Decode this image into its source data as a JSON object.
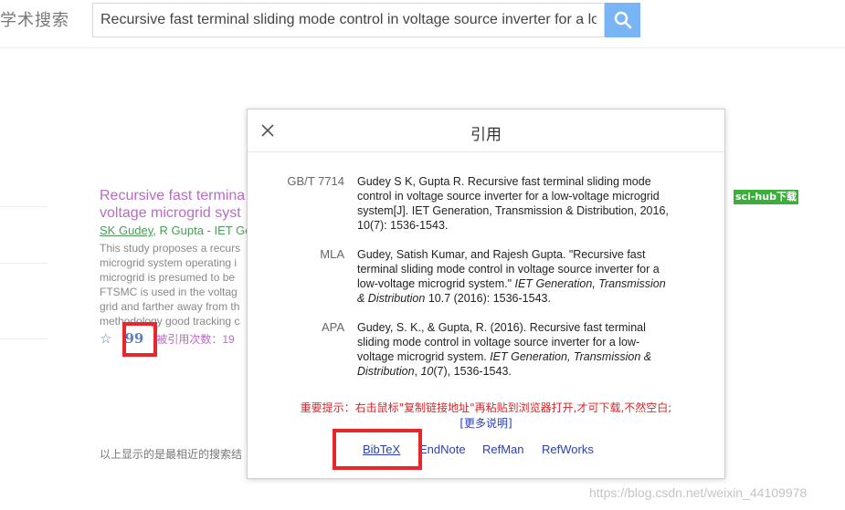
{
  "header": {
    "logo_text": "学术搜索",
    "search_value": "Recursive fast terminal sliding mode control in voltage source inverter for a lo",
    "search_icon": "search-icon"
  },
  "result": {
    "title_line1": "Recursive fast termina",
    "title_line2": "voltage microgrid syst",
    "author_linked": "SK Gudey",
    "author_rest": ", R Gupta - IET Ge",
    "snippet": [
      "This study proposes a recurs",
      "microgrid system operating i",
      "microgrid is presumed to be",
      "FTSMC is used in the voltag",
      "grid and farther away from th",
      "methodology good tracking c"
    ],
    "quote_glyph": "99",
    "cited_by": "被引用次数：19",
    "scihub_label": "sci-hub下载"
  },
  "footer_note": "以上显示的是最相近的搜索结",
  "modal": {
    "title": "引用",
    "citations": [
      {
        "label": "GB/T 7714",
        "lines": [
          "Gudey S K, Gupta R. Recursive fast terminal sliding mode",
          "control in voltage source inverter for a low-voltage microgrid",
          "system[J]. IET Generation, Transmission & Distribution, 2016,",
          "10(7): 1536-1543."
        ]
      },
      {
        "label": "MLA",
        "line1": "Gudey, Satish Kumar, and Rajesh Gupta. \"Recursive fast",
        "line2": "terminal sliding mode control in voltage source inverter for a",
        "line3_a": "low-voltage microgrid system.\" ",
        "line3_b": "IET Generation, Transmission",
        "line4_a": "& Distribution",
        "line4_b": " 10.7 (2016): 1536-1543."
      },
      {
        "label": "APA",
        "line1": "Gudey, S. K., & Gupta, R. (2016). Recursive fast terminal",
        "line2": "sliding mode control in voltage source inverter for a low-",
        "line3_a": "voltage microgrid system. ",
        "line3_b": "IET Generation, Transmission &",
        "line4_a": "Distribution",
        "line4_b": ", ",
        "line4_c": "10",
        "line4_d": "(7), 1536-1543."
      }
    ],
    "notice": "重要提示：右击鼠标\"复制链接地址\"再粘贴到浏览器打开,才可下载,不然空白;",
    "more_link": "[更多说明]",
    "export_links": [
      "BibTeX",
      "EndNote",
      "RefMan",
      "RefWorks"
    ]
  },
  "watermark": "https://blog.csdn.net/weixin_44109978",
  "colors": {
    "highlight": "#e8272d",
    "link": "#2a3fb3",
    "visited_title": "#b96bc6",
    "search_button": "#79b4f5"
  }
}
